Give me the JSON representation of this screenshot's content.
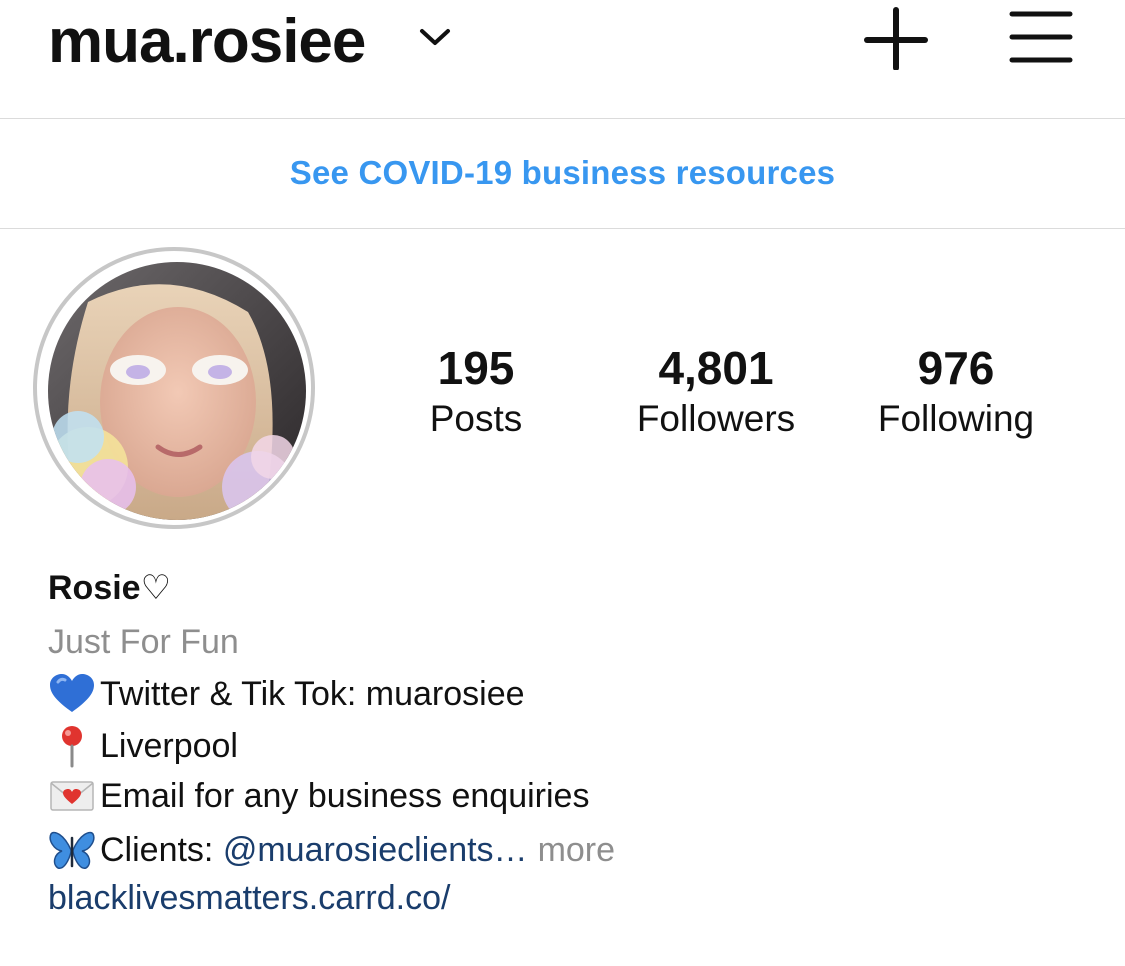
{
  "header": {
    "username": "mua.rosiee",
    "icons": {
      "account_switch": "chevron-down-icon",
      "create": "plus-icon",
      "menu": "hamburger-menu-icon"
    }
  },
  "banner": {
    "link_text": "See COVID-19 business resources"
  },
  "profile": {
    "avatar": "profile-photo",
    "stats": [
      {
        "value": "195",
        "label": "Posts"
      },
      {
        "value": "4,801",
        "label": "Followers"
      },
      {
        "value": "976",
        "label": "Following"
      }
    ]
  },
  "bio": {
    "name": "Rosie♡",
    "category": "Just For Fun",
    "lines": [
      {
        "icon": "blue-heart-icon",
        "text": "Twitter & Tik Tok: muarosiee"
      },
      {
        "icon": "pushpin-icon",
        "text": "Liverpool"
      },
      {
        "icon": "love-letter-icon",
        "text": "Email for any business enquiries"
      }
    ],
    "clients": {
      "icon": "butterfly-icon",
      "prefix": "Clients: ",
      "mention": "@muarosieclients…",
      "more": "more"
    },
    "link": "blacklivesmatters.carrd.co/"
  },
  "colors": {
    "link_blue": "#3897f0",
    "mention_navy": "#1a3d6c",
    "muted_gray": "#8e8e8e",
    "divider": "#dbdbdb"
  }
}
